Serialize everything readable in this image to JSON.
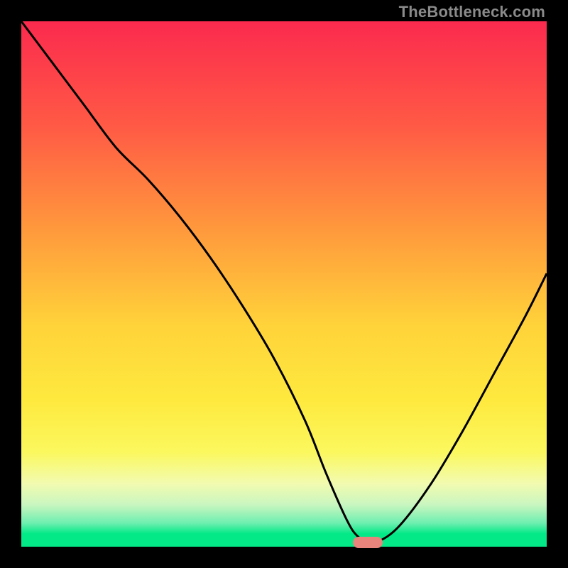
{
  "watermark": "TheBottleneck.com",
  "colors": {
    "top": "#fb2a4e",
    "mid1": "#ff6a3f",
    "mid2": "#ffb43a",
    "mid3": "#fee13b",
    "mid4": "#fbf85e",
    "bottom_band_top": "#f7fccb",
    "bottom_green": "#04e988",
    "marker": "#e9847c",
    "curve": "#000000"
  },
  "chart_data": {
    "type": "line",
    "title": "",
    "xlabel": "",
    "ylabel": "",
    "xlim": [
      0,
      100
    ],
    "ylim": [
      0,
      100
    ],
    "series": [
      {
        "name": "bottleneck-curve",
        "x": [
          0,
          6,
          12,
          18,
          24,
          30,
          36,
          42,
          48,
          54,
          58,
          62,
          64,
          66,
          68,
          72,
          78,
          84,
          90,
          96,
          100
        ],
        "y": [
          100,
          92,
          84,
          76,
          70,
          63,
          55,
          46,
          36,
          24,
          14,
          5,
          2,
          1,
          1,
          4,
          12,
          22,
          33,
          44,
          52
        ]
      }
    ],
    "optimal_marker": {
      "x": 66,
      "y": 0.8
    },
    "gradient_stops": [
      {
        "offset": 0.0,
        "color": "#fb2a4e"
      },
      {
        "offset": 0.2,
        "color": "#ff5a45"
      },
      {
        "offset": 0.4,
        "color": "#ff9a3c"
      },
      {
        "offset": 0.58,
        "color": "#ffd33a"
      },
      {
        "offset": 0.72,
        "color": "#fee93e"
      },
      {
        "offset": 0.82,
        "color": "#fbf85e"
      },
      {
        "offset": 0.88,
        "color": "#f2fbb0"
      },
      {
        "offset": 0.92,
        "color": "#c9f6c0"
      },
      {
        "offset": 0.955,
        "color": "#6eefb0"
      },
      {
        "offset": 0.975,
        "color": "#04e988"
      },
      {
        "offset": 1.0,
        "color": "#04e988"
      }
    ]
  }
}
